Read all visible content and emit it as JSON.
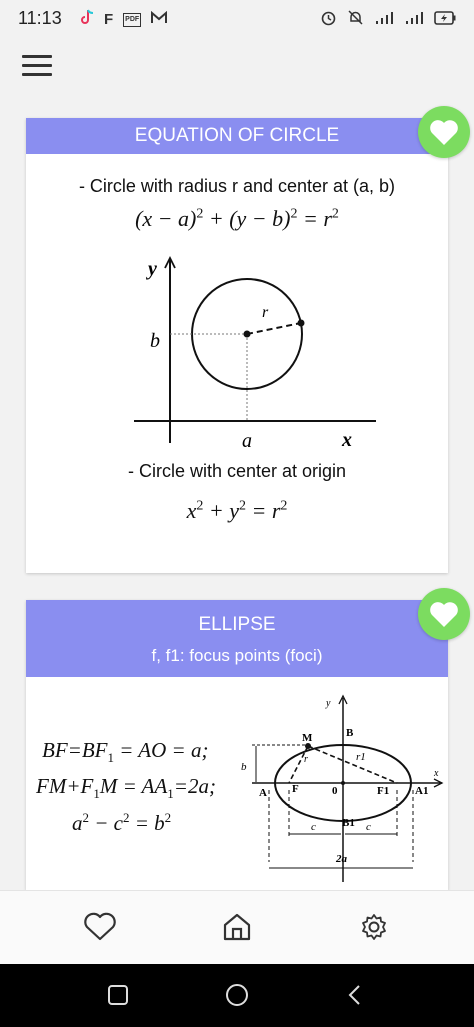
{
  "status": {
    "time": "11:13",
    "left_icons": [
      "tiktok-icon",
      "f-icon",
      "pdf-icon",
      "gmail-icon"
    ],
    "left_text": {
      "f": "F",
      "pdf": "PDF"
    },
    "right_icons": [
      "alarm-icon",
      "mute-icon",
      "signal-icon",
      "signal-icon",
      "battery-icon"
    ]
  },
  "cards": {
    "circle": {
      "title": "EQUATION OF CIRCLE",
      "line1": "- Circle with radius r and center at (a, b)",
      "formula1": "(x − a)",
      "formula1_b": " + (y − b)",
      "formula1_c": " = r",
      "exp": "2",
      "diagram": {
        "y": "y",
        "x": "x",
        "b": "b",
        "a": "a",
        "r": "r"
      },
      "line2": "- Circle with center at origin",
      "formula2_a": "x",
      "formula2_b": " + y",
      "formula2_c": " = r"
    },
    "ellipse": {
      "title": "ELLIPSE",
      "subtitle": "f, f1: focus points (foci)",
      "eq1_a": "BF=BF",
      "eq1_sub": "1",
      "eq1_b": " = AO = a;",
      "eq2_a": "FM+F",
      "eq2_sub": "1",
      "eq2_b": "M = AA",
      "eq2_sub2": "1",
      "eq2_c": "=2a;",
      "eq3_a": "a",
      "eq3_b": " − c",
      "eq3_c": " = b",
      "exp": "2",
      "diagram": {
        "y": "y",
        "x": "x",
        "M": "M",
        "B": "B",
        "r": "r",
        "r1": "r1",
        "b": "b",
        "A": "A",
        "F": "F",
        "O": "0",
        "F1": "F1",
        "A1": "A1",
        "c_left": "c",
        "B1": "B1",
        "c_right": "c",
        "two_a": "2a"
      }
    }
  },
  "colors": {
    "header": "#8a8ef0",
    "fav": "#7cdc60",
    "background": "#f2f2f2"
  },
  "nav": {
    "items": [
      "heart-icon",
      "home-icon",
      "gear-icon"
    ]
  },
  "system_nav": {
    "items": [
      "recent-apps-icon",
      "home-circle-icon",
      "back-icon"
    ]
  }
}
